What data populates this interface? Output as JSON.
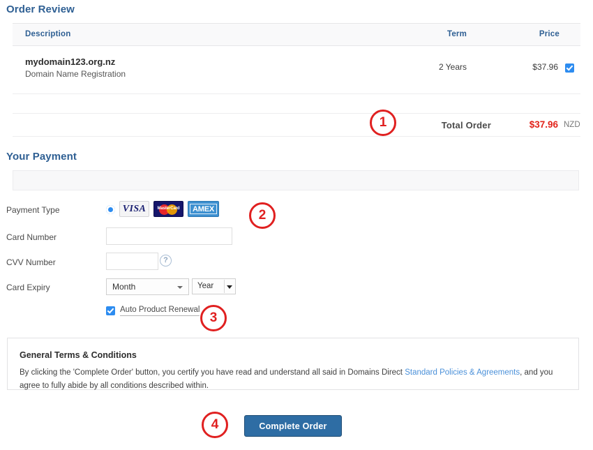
{
  "order_review": {
    "heading": "Order Review",
    "columns": {
      "description": "Description",
      "term": "Term",
      "price": "Price"
    },
    "items": [
      {
        "title": "mydomain123.org.nz",
        "subtitle": "Domain Name Registration",
        "term": "2 Years",
        "price": "$37.96",
        "selected": true
      }
    ],
    "total": {
      "label": "Total Order",
      "amount": "$37.96",
      "currency": "NZD",
      "amount_color": "#e2231a"
    }
  },
  "your_payment": {
    "heading": "Your Payment",
    "payment_type": {
      "label": "Payment Type",
      "selected": "visa",
      "cards": [
        {
          "id": "visa",
          "text": "VISA"
        },
        {
          "id": "mastercard",
          "text": "MasterCard"
        },
        {
          "id": "amex",
          "text": "AMEX"
        }
      ]
    },
    "card_number": {
      "label": "Card Number",
      "value": "",
      "placeholder": ""
    },
    "cvv_number": {
      "label": "CVV Number",
      "value": "",
      "placeholder": "",
      "help_glyph": "?"
    },
    "card_expiry": {
      "label": "Card Expiry",
      "month_selected": "Month",
      "year_selected": "Year"
    },
    "auto_renewal": {
      "label": "Auto Product Renewal",
      "checked": true
    }
  },
  "terms": {
    "title": "General Terms & Conditions",
    "body_before_link": "By clicking the 'Complete Order' button, you certify you have read and understand all said in Domains Direct ",
    "link_text": "Standard Policies & Agreements",
    "body_after_link": ", and you agree to fully abide by all conditions described within."
  },
  "actions": {
    "complete_order": "Complete Order"
  },
  "markers": {
    "one": "1",
    "two": "2",
    "three": "3",
    "four": "4",
    "color": "#e02020"
  },
  "theme": {
    "heading_blue": "#2e5f93",
    "accent_blue": "#2d8cf0",
    "button_blue": "#2e6da4",
    "link_blue": "#4a90d9",
    "price_red": "#e2231a"
  }
}
